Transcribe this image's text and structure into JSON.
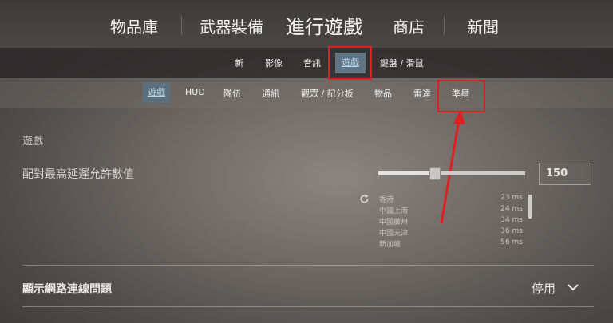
{
  "top_nav": {
    "tabs": [
      {
        "label": "物品庫"
      },
      {
        "label": "武器裝備"
      },
      {
        "label": "進行遊戲"
      },
      {
        "label": "商店"
      },
      {
        "label": "新聞"
      }
    ]
  },
  "sub_nav": {
    "items": [
      {
        "label": "新"
      },
      {
        "label": "影像"
      },
      {
        "label": "音訊"
      },
      {
        "label": "遊戲"
      },
      {
        "label": "鍵盤 / 滑鼠"
      }
    ]
  },
  "game_tabs": {
    "items": [
      {
        "label": "遊戲"
      },
      {
        "label": "HUD"
      },
      {
        "label": "隊伍"
      },
      {
        "label": "通訊"
      },
      {
        "label": "觀眾 / 記分板"
      },
      {
        "label": "物品"
      },
      {
        "label": "雷達"
      },
      {
        "label": "準星"
      }
    ]
  },
  "section": {
    "title": "遊戲"
  },
  "max_ping": {
    "label": "配對最高延遲允許數值",
    "value": "150",
    "slider_fraction": 0.38
  },
  "ping_list": [
    {
      "region": "香港",
      "ms": "23 ms"
    },
    {
      "region": "中國上海",
      "ms": "24 ms"
    },
    {
      "region": "中國廣州",
      "ms": "34 ms"
    },
    {
      "region": "中國天津",
      "ms": "36 ms"
    },
    {
      "region": "新加坡",
      "ms": "56 ms"
    }
  ],
  "network_issues": {
    "label": "顯示網路連線問題",
    "value": "停用"
  },
  "colors": {
    "accent": "#5f7584",
    "highlight": "#e02020"
  }
}
